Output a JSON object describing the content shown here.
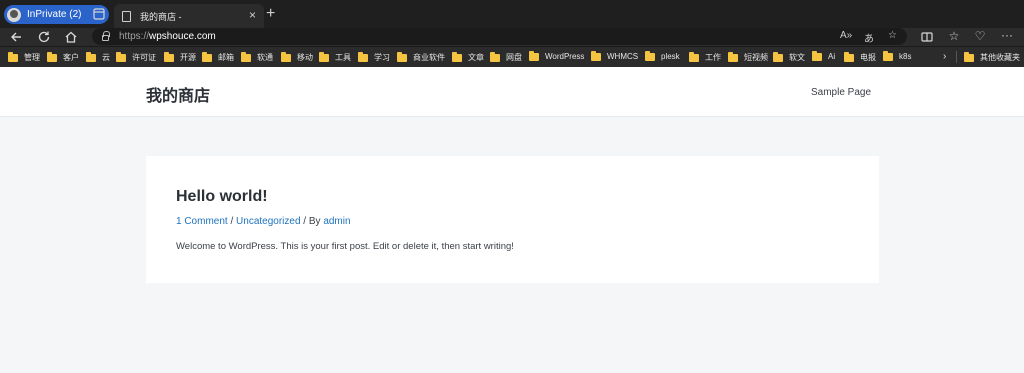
{
  "browser": {
    "profile_label": "InPrivate (2)",
    "tab_title": "我的商店 -",
    "url_protocol": "https://",
    "url_host": "wpshouce.com",
    "icons": {
      "back": "arrow-left-icon",
      "refresh": "refresh-icon",
      "home": "home-icon",
      "read_aloud": "read-aloud-icon",
      "translate": "translate-icon",
      "favorite": "star-icon",
      "split": "split-screen-icon",
      "favorites": "favorites-icon",
      "health": "browser-essentials-icon",
      "more": "more-icon"
    }
  },
  "bookmarks": [
    "管理",
    "客户",
    "云",
    "许可证",
    "开源",
    "邮箱",
    "软通",
    "移动",
    "工具",
    "学习",
    "商业软件",
    "文章",
    "网盘",
    "WordPress",
    "WHMCS",
    "plesk",
    "工作",
    "短视频",
    "软文",
    "Ai",
    "电报",
    "k8s"
  ],
  "bookmarks_other": "其他收藏夹",
  "site": {
    "title": "我的商店",
    "nav": [
      "Sample Page"
    ]
  },
  "post": {
    "title": "Hello world!",
    "comments": "1 Comment",
    "sep1": " / ",
    "category": "Uncategorized",
    "sep2": " / By ",
    "author": "admin",
    "excerpt": "Welcome to WordPress. This is your first post. Edit or delete it, then start writing!"
  },
  "colors": {
    "link": "#1e73be",
    "profile_pill": "#2a63c9",
    "page_bg": "#f5f6f8"
  }
}
